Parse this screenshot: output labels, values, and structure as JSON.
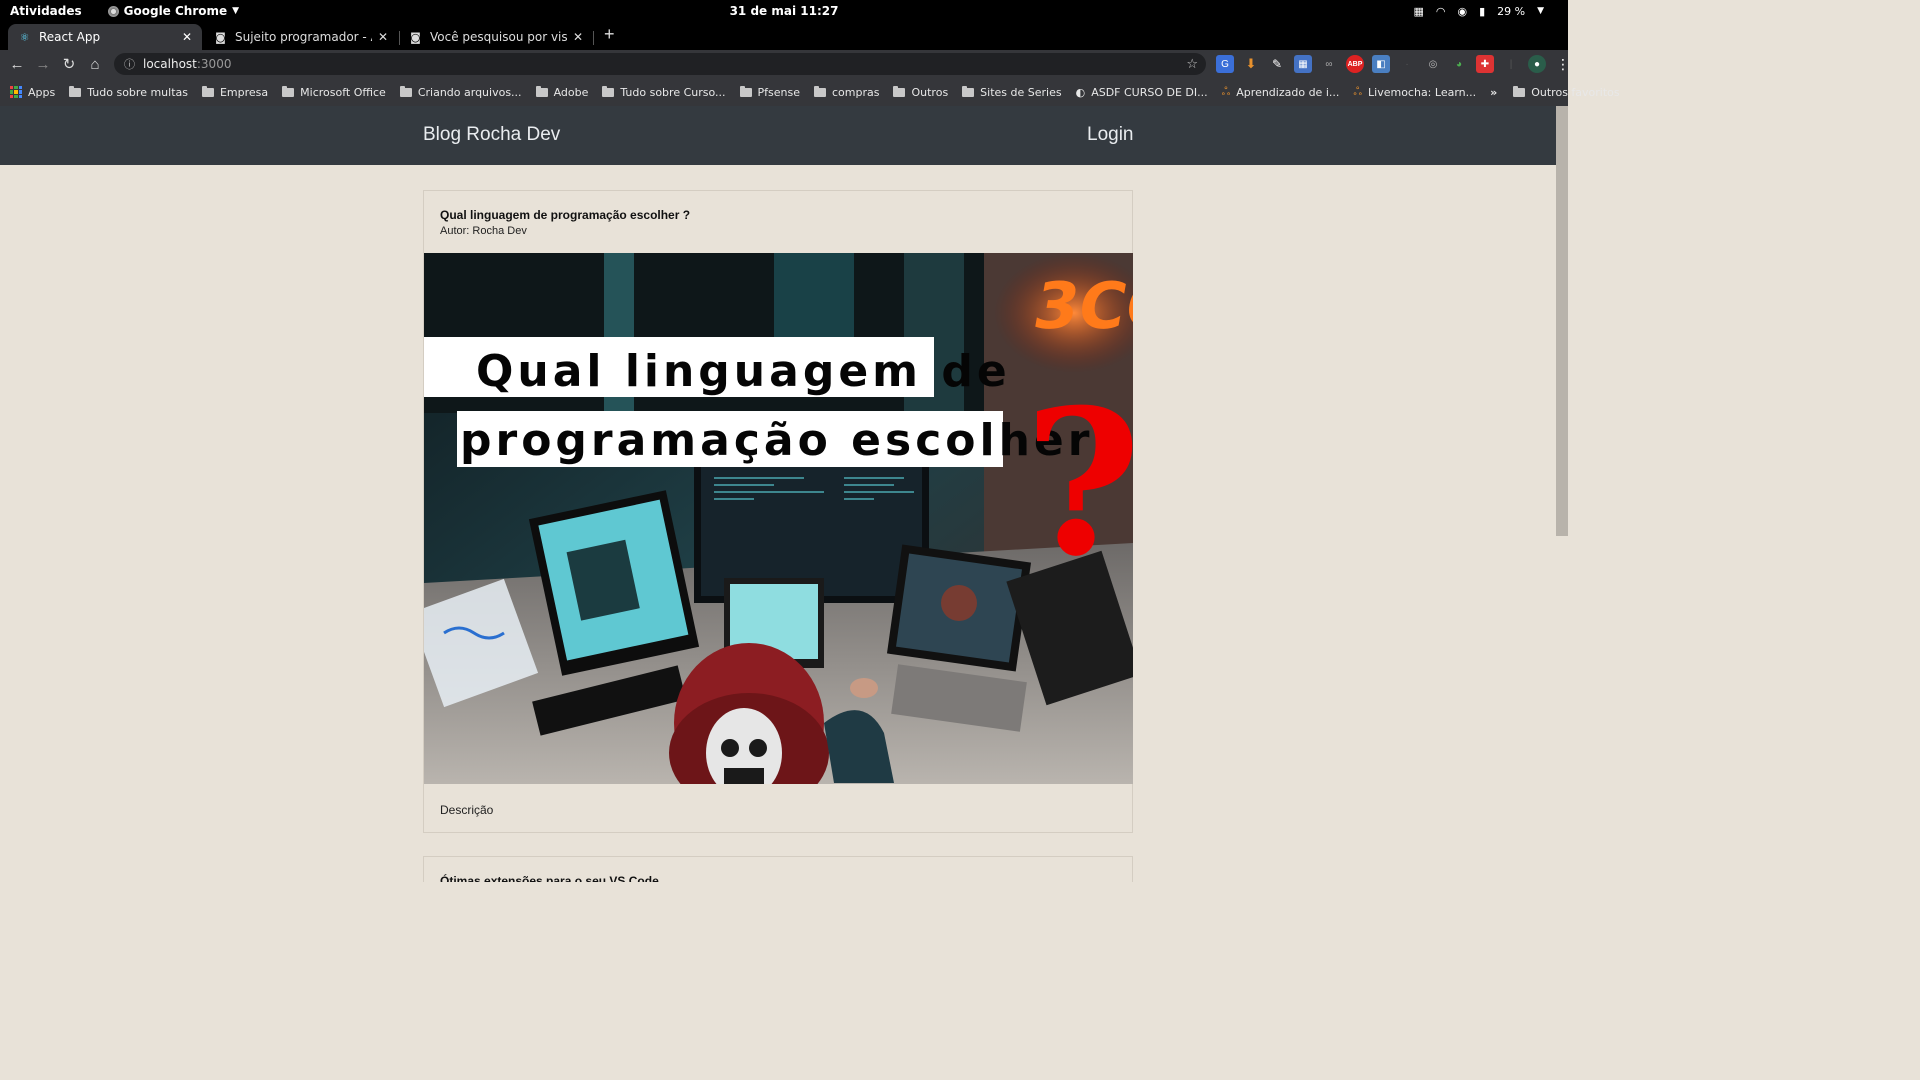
{
  "system_bar": {
    "activities": "Atividades",
    "app_name": "Google Chrome",
    "clock": "31 de mai  11:27",
    "battery": "29 %"
  },
  "tabs": [
    {
      "title": "React App",
      "active": true
    },
    {
      "title": "Sujeito programador - Apaixo",
      "active": false
    },
    {
      "title": "Você pesquisou por visual stu",
      "active": false
    }
  ],
  "toolbar": {
    "url_host": "localhost",
    "url_port": ":3000"
  },
  "bookmarks": {
    "apps": "Apps",
    "items": [
      "Tudo sobre multas",
      "Empresa",
      "Microsoft Office",
      "Criando arquivos...",
      "Adobe",
      "Tudo sobre Curso...",
      "Pfsense",
      "compras",
      "Outros",
      "Sites de Series"
    ],
    "special": [
      "ASDF CURSO DE DI...",
      "Aprendizado de i...",
      "Livemocha: Learn..."
    ],
    "overflow": "»",
    "other": "Outros favoritos"
  },
  "site": {
    "brand": "Blog Rocha Dev",
    "login": "Login"
  },
  "posts": [
    {
      "title": "Qual linguagem de programação escolher ?",
      "author": "Autor: Rocha Dev",
      "image_line1": "Qual linguagem de",
      "image_line2": "programação escolher",
      "image_mark": "?",
      "description": "Descrição"
    },
    {
      "title": "Ótimas extensões para o seu VS Code"
    }
  ]
}
